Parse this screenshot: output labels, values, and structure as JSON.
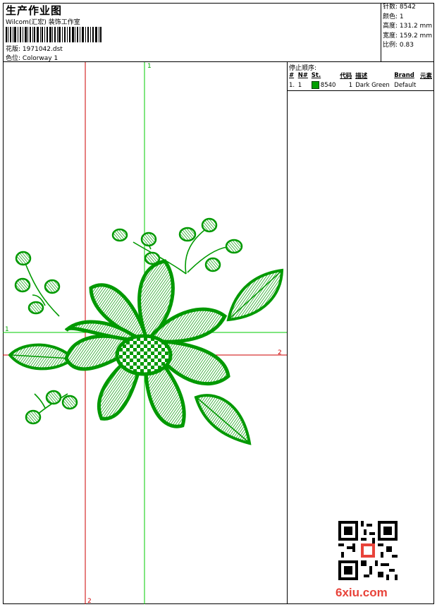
{
  "header": {
    "title": "生产作业图",
    "company": "Wilcom(汇宏) 装饰工作室",
    "design_label": "花版:",
    "design_value": "1971042.dst",
    "colorway_label": "色位:",
    "colorway_value": "Colorway 1"
  },
  "stats": {
    "stitches_label": "针数:",
    "stitches_value": "8542",
    "colors_label": "颜色:",
    "colors_value": "1",
    "height_label": "高度:",
    "height_value": "131.2 mm",
    "width_label": "宽度:",
    "width_value": "159.2 mm",
    "ratio_label": "比例:",
    "ratio_value": "0.83"
  },
  "sequence": {
    "title": "停止顺序:",
    "columns": [
      "#",
      "N#",
      "St.",
      "代码",
      "描述",
      "Brand",
      "元素"
    ],
    "rows": [
      {
        "index": "1.",
        "needle": "1",
        "stitches": "8540",
        "code": "1",
        "description": "Dark Green",
        "brand": "Default",
        "element": ""
      }
    ]
  },
  "canvas": {
    "axis_labels": {
      "v1": "1",
      "h1": "1",
      "h2": "2",
      "v2": "2"
    },
    "thread_color": "#009900",
    "guide_green": "#00cc00",
    "guide_red": "#cc0000"
  },
  "watermark": "6xiu.com"
}
